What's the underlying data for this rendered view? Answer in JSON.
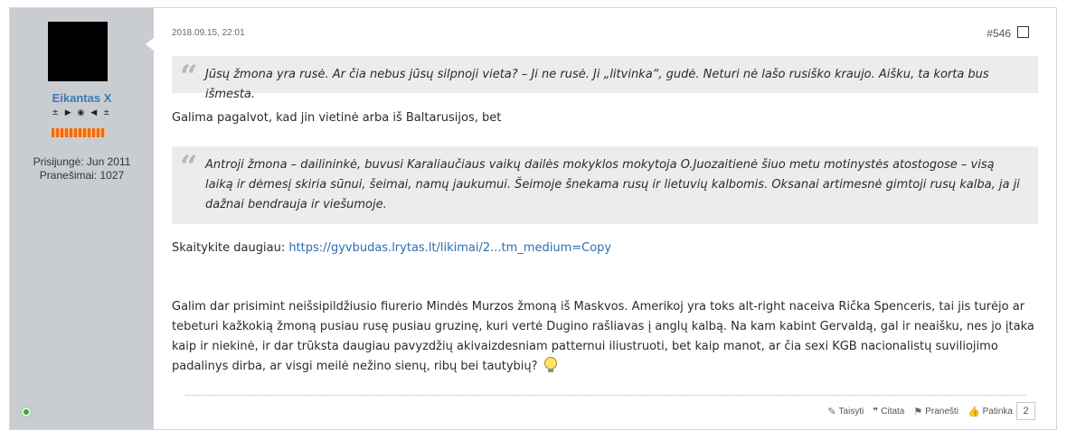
{
  "user": {
    "name": "Eikantas X",
    "rank_icons": "± ▶ ◉ ◀ ±",
    "joined": "Prisijungė: Jun 2011",
    "posts": "Pranešimai: 1027",
    "online_color": "#46a43a"
  },
  "post": {
    "date": "2018.09.15, 22:01",
    "number": "#546",
    "quote1": "Jūsų žmona yra rusė. Ar čia nebus jūsų silpnoji vieta? – Ji ne rusė. Ji „litvinka“, gudė. Neturi nė lašo rusiško kraujo. Aišku, ta korta bus išmesta.",
    "text1": "Galima pagalvot, kad jin vietinė arba iš Baltarusijos, bet",
    "quote2": "Antroji žmona – dailininkė, buvusi Karaliaučiaus vaikų dailės mokyklos mokytoja O.Juozaitienė šiuo metu motinystės atostogose – visą laiką ir dėmesį skiria sūnui, šeimai, namų jaukumui. Šeimoje šnekama rusų ir lietuvių kalbomis. Oksanai artimesnė gimtoji rusų kalba, ja ji dažnai bendrauja ir viešumoje.",
    "read_more_label": "Skaitykite daugiau:",
    "read_more_link": "https://gyvbudas.lrytas.lt/likimai/2...tm_medium=Copy",
    "text2": "Galim dar prisimint neišsipildžiusio fiurerio Mindės Murzos žmoną iš Maskvos. Amerikoj yra toks alt-right naceiva Rička Spenceris, tai jis turėjo ar tebeturi kažkokią žmoną pusiau rusę pusiau gruzinę, kuri vertė Dugino rašliavas į anglų kalbą. Na kam kabint Gervaldą, gal ir neaišku, nes jo įtaka kaip ir niekinė, ir dar trūksta daugiau pavyzdžių akivaizdesniam patternui iliustruoti, bet kaip manot, ar čia sexi KGB nacionalistų suviliojimo padalinys dirba, ar visgi meilė nežino sienų, ribų bei tautybių?"
  },
  "actions": {
    "edit": "Taisyti",
    "quote": "Citata",
    "report": "Pranešti",
    "like": "Patinka",
    "like_count": "2"
  },
  "icons": {
    "edit": "pencil-icon",
    "quote": "quote-icon",
    "report": "flag-icon",
    "like": "thumbs-up-icon",
    "smiley": "lightbulb-smiley-icon"
  },
  "colors": {
    "link": "#2a6fb0",
    "username": "#3a7ab8",
    "rank_bar": "#ee6a12",
    "quote_bg": "#ececec"
  }
}
